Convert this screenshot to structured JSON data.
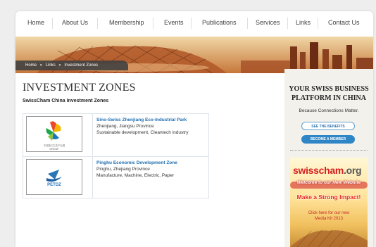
{
  "nav": {
    "items": [
      "Home",
      "About Us",
      "Membership",
      "Events",
      "Publications",
      "Services",
      "Links",
      "Contact Us"
    ]
  },
  "breadcrumb": {
    "items": [
      "Home",
      "Links",
      "Investment Zones"
    ],
    "separator": "»"
  },
  "main": {
    "title": "INVESTMENT ZONES",
    "subtitle": "SwissCham China Investment Zones",
    "zones": [
      {
        "name": "Sino-Swiss Zhenjiang Eco-Industrial Park",
        "location": "Zhenjiang, Jiangsu Province",
        "sectors": "Sustainable development, Cleantech industry",
        "logo_text": "GROUP"
      },
      {
        "name": "Pinghu Economic Development Zone",
        "location": "Pinghu, Zhejiang Province",
        "sectors": "Manufacture, Machine, Electric, Paper",
        "logo_text": "PETDZ"
      }
    ]
  },
  "sidebar": {
    "title_line1": "YOUR SWISS BUSINESS",
    "title_line2": "PLATFORM IN CHINA",
    "tagline": "Because Connections Matter.",
    "benefits_button": "SEE THE BENEFITS",
    "member_button": "BECOME A MEMBER",
    "ad": {
      "logo_main": "swisscham",
      "logo_suffix": ".org",
      "welcome": "Welcome to our New Website",
      "impact": "Make a Strong Impact!",
      "click_line1": "Click here for our new",
      "click_line2": "Media Kit 2013"
    }
  },
  "colors": {
    "link_blue": "#1e6db0",
    "button_blue": "#2f86c6",
    "ad_red": "#d51f1f",
    "banner_orange": "#c57d3b"
  }
}
